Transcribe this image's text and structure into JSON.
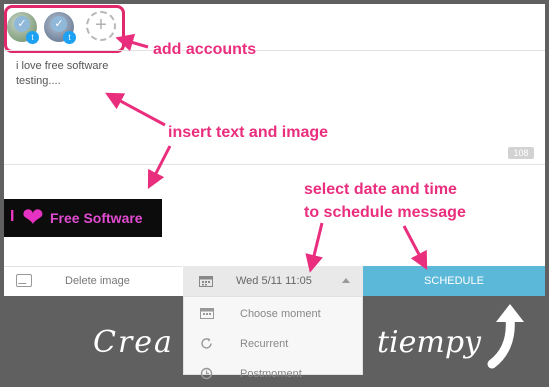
{
  "composer": {
    "accounts": [
      {
        "name": "account-1"
      },
      {
        "name": "account-2"
      }
    ],
    "message_text": "i love free software\ntesting....",
    "char_count": "108",
    "attached_image": {
      "letter": "I",
      "text": "Free Software"
    }
  },
  "bottom_bar": {
    "delete_image_label": "Delete image",
    "date_label": "Wed  5/11 11:05",
    "schedule_label": "SCHEDULE"
  },
  "dropdown": {
    "items": [
      {
        "label": "Choose moment",
        "icon": "calendar-icon"
      },
      {
        "label": "Recurrent",
        "icon": "refresh-icon"
      },
      {
        "label": "Postmoment",
        "icon": "clock-icon"
      }
    ]
  },
  "background_text": {
    "left": "Crea",
    "right": "tiempy"
  },
  "annotations": {
    "add_accounts": "add accounts",
    "insert_text": "insert text and image",
    "select_date_line1": "select date and time",
    "select_date_line2": "to schedule message"
  },
  "colors": {
    "schedule": "#5cb8d8",
    "annotation": "#ea2e7e",
    "background": "#606060"
  }
}
